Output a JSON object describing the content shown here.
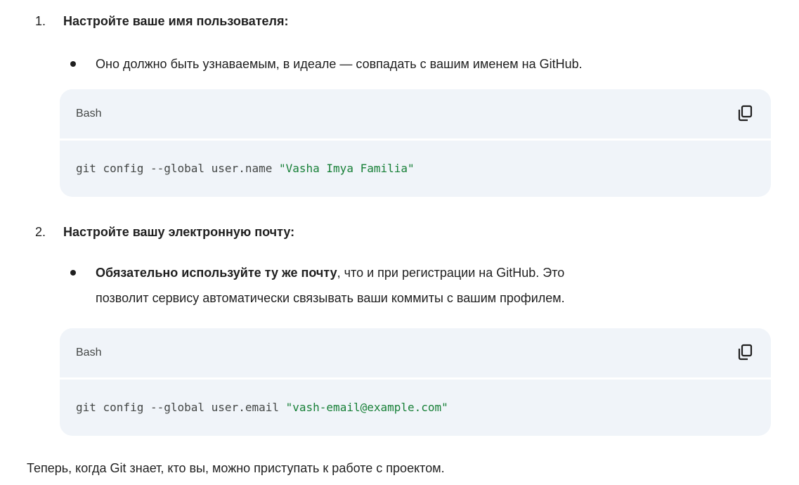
{
  "steps": [
    {
      "number": "1.",
      "title": "Настройте ваше имя пользователя:",
      "bullet": "Оно должно быть узнаваемым, в идеале — совпадать с вашим именем на GitHub.",
      "code": {
        "language": "Bash",
        "command": "git config --global user.name ",
        "string": "\"Vasha Imya Familia\""
      }
    },
    {
      "number": "2.",
      "title": "Настройте вашу электронную почту:",
      "bullet_bold": "Обязательно используйте ту же почту",
      "bullet_line1_rest": ", что и при регистрации на GitHub. Это",
      "bullet_line2": "позволит сервису автоматически связывать ваши коммиты с вашим профилем.",
      "code": {
        "language": "Bash",
        "command": "git config --global user.email ",
        "string": "\"vash-email@example.com\""
      }
    }
  ],
  "footer": "Теперь, когда Git знает, кто вы, можно приступать к работе с проектом.",
  "icons": {
    "copy": "copy-icon"
  },
  "colors": {
    "code_background": "#f0f4f9",
    "string": "#188038",
    "text": "#1f1f1f",
    "muted": "#444746"
  }
}
